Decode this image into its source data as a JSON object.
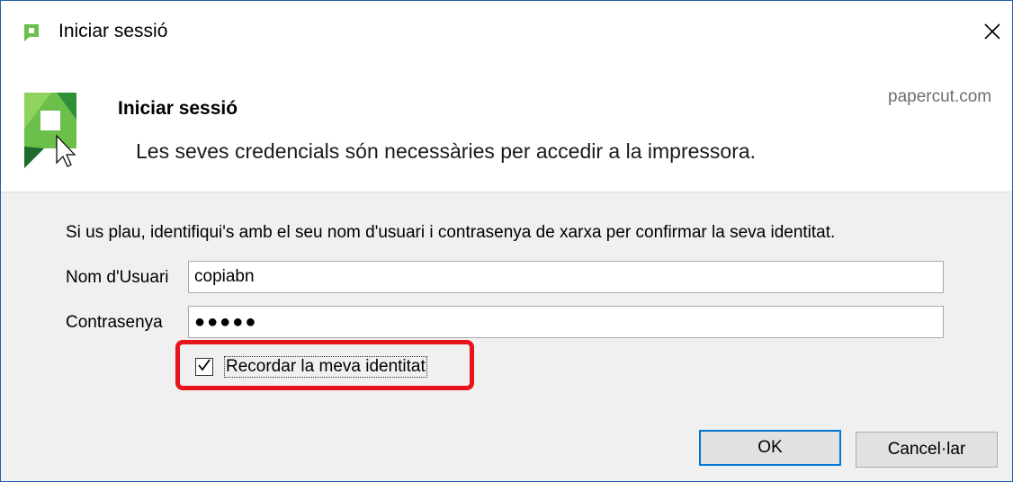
{
  "window": {
    "title": "Iniciar sessió"
  },
  "header": {
    "title": "Iniciar sessió",
    "subtitle": "Les seves credencials són necessàries per accedir a la impressora.",
    "brand": "papercut.com"
  },
  "form": {
    "instructions": "Si us plau, identifiqui's amb el seu nom d'usuari i contrasenya de xarxa per confirmar la seva identitat.",
    "username_label": "Nom d'Usuari",
    "username_value": "copiabn",
    "password_label": "Contrasenya",
    "password_value": "●●●●●",
    "remember_label": "Recordar la meva identitat",
    "remember_checked": true
  },
  "buttons": {
    "ok_label": "OK",
    "cancel_label": "Cancel·lar"
  },
  "icons": {
    "app": "papercut-logo-icon",
    "close": "close-icon",
    "checkbox": "checkmark-icon"
  },
  "colors": {
    "highlight": "#e8141c",
    "ok_border": "#0078d7",
    "logo_green": "#6cc04a"
  }
}
